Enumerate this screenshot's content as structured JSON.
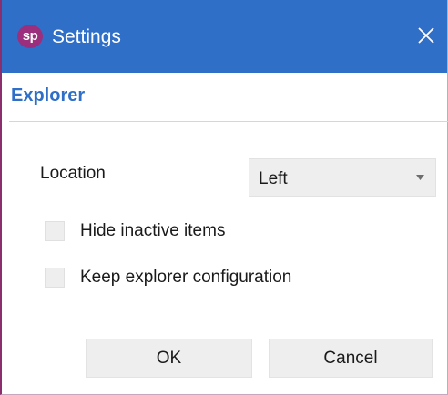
{
  "window": {
    "title": "Settings",
    "logo_text": "sp",
    "close_icon": "close-icon"
  },
  "section": {
    "title": "Explorer"
  },
  "location": {
    "label": "Location",
    "selected": "Left",
    "arrow_icon": "chevron-down-icon"
  },
  "options": {
    "hide_inactive_label": "Hide inactive items",
    "hide_inactive_checked": false,
    "keep_config_label": "Keep explorer configuration",
    "keep_config_checked": false
  },
  "buttons": {
    "ok_label": "OK",
    "cancel_label": "Cancel"
  },
  "colors": {
    "titlebar": "#2f6fc8",
    "logo": "#9b2f7d",
    "accent_text": "#2f6fc8",
    "window_border": "#8b2e6e"
  }
}
